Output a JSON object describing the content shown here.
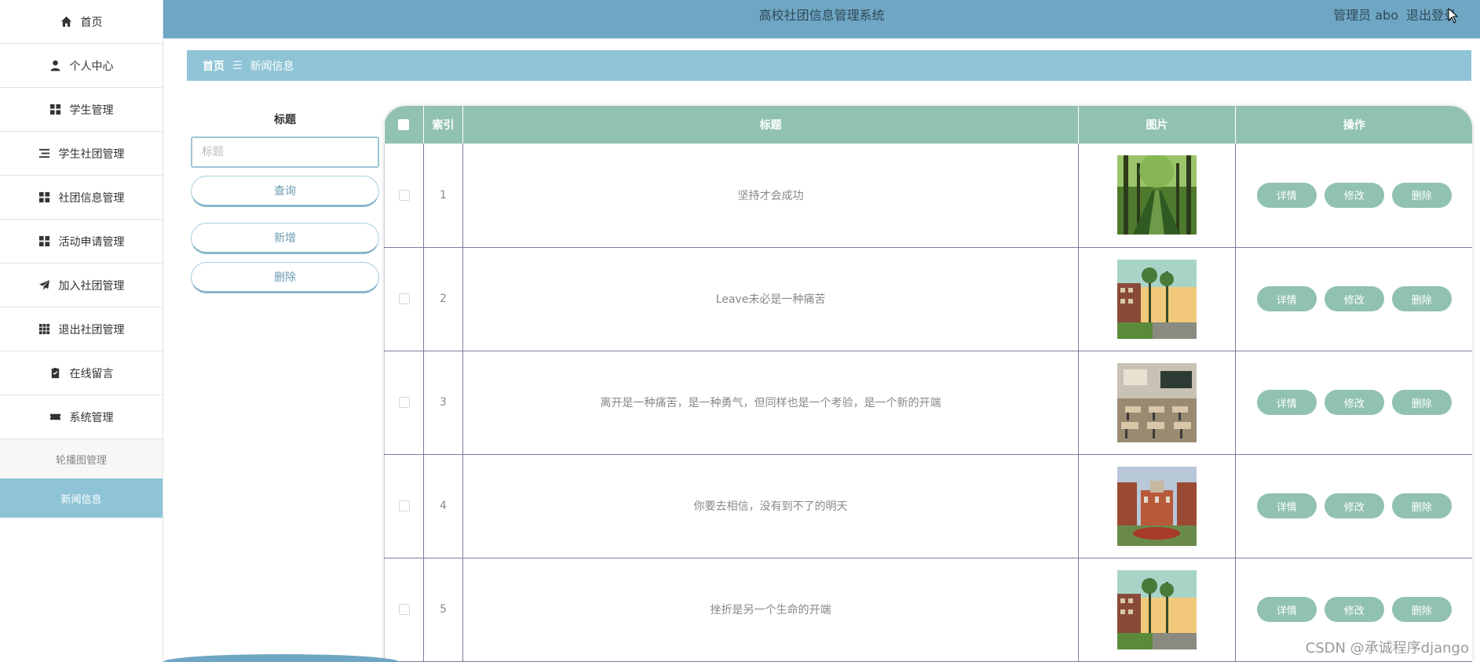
{
  "header": {
    "title": "高校社团信息管理系统",
    "user_label": "管理员 abo",
    "logout_label": "退出登录"
  },
  "sidebar": {
    "items": [
      {
        "label": "首页",
        "icon": "home-icon"
      },
      {
        "label": "个人中心",
        "icon": "user-icon"
      },
      {
        "label": "学生管理",
        "icon": "grid-icon"
      },
      {
        "label": "学生社团管理",
        "icon": "list-icon"
      },
      {
        "label": "社团信息管理",
        "icon": "grid-icon"
      },
      {
        "label": "活动申请管理",
        "icon": "grid-icon"
      },
      {
        "label": "加入社团管理",
        "icon": "paper-plane-icon"
      },
      {
        "label": "退出社团管理",
        "icon": "apps-icon"
      },
      {
        "label": "在线留言",
        "icon": "clipboard-check-icon"
      },
      {
        "label": "系统管理",
        "icon": "ticket-icon"
      }
    ],
    "sub_items": [
      {
        "label": "轮播图管理",
        "active": false
      },
      {
        "label": "新闻信息",
        "active": true
      }
    ]
  },
  "breadcrumb": {
    "home": "首页",
    "separator": "☰",
    "current": "新闻信息"
  },
  "search": {
    "label": "标题",
    "placeholder": "标题",
    "query_button": "查询",
    "add_button": "新增",
    "delete_button": "删除"
  },
  "table": {
    "headers": {
      "index": "索引",
      "title": "标题",
      "image": "图片",
      "actions": "操作"
    },
    "actions": {
      "detail": "详情",
      "edit": "修改",
      "delete": "删除"
    },
    "rows": [
      {
        "index": "1",
        "title": "坚持才会成功",
        "image": "tree-lined-path-photo"
      },
      {
        "index": "2",
        "title": "Leave未必是一种痛苦",
        "image": "campus-building-sunset-photo"
      },
      {
        "index": "3",
        "title": "离开是一种痛苦，是一种勇气，但同样也是一个考验，是一个新的开端",
        "image": "classroom-photo"
      },
      {
        "index": "4",
        "title": "你要去相信，没有到不了的明天",
        "image": "campus-plaza-photo"
      },
      {
        "index": "5",
        "title": "挫折是另一个生命的开端",
        "image": "campus-building-sunset-photo"
      }
    ]
  },
  "watermark": "CSDN @承诚程序django",
  "colors": {
    "header_bg": "#6fa6c3",
    "breadcrumb_bg": "#8fc4d6",
    "table_header_bg": "#91c1b3",
    "action_button_bg": "#91c1b3",
    "active_sub_item_bg": "#8fc4d6"
  }
}
